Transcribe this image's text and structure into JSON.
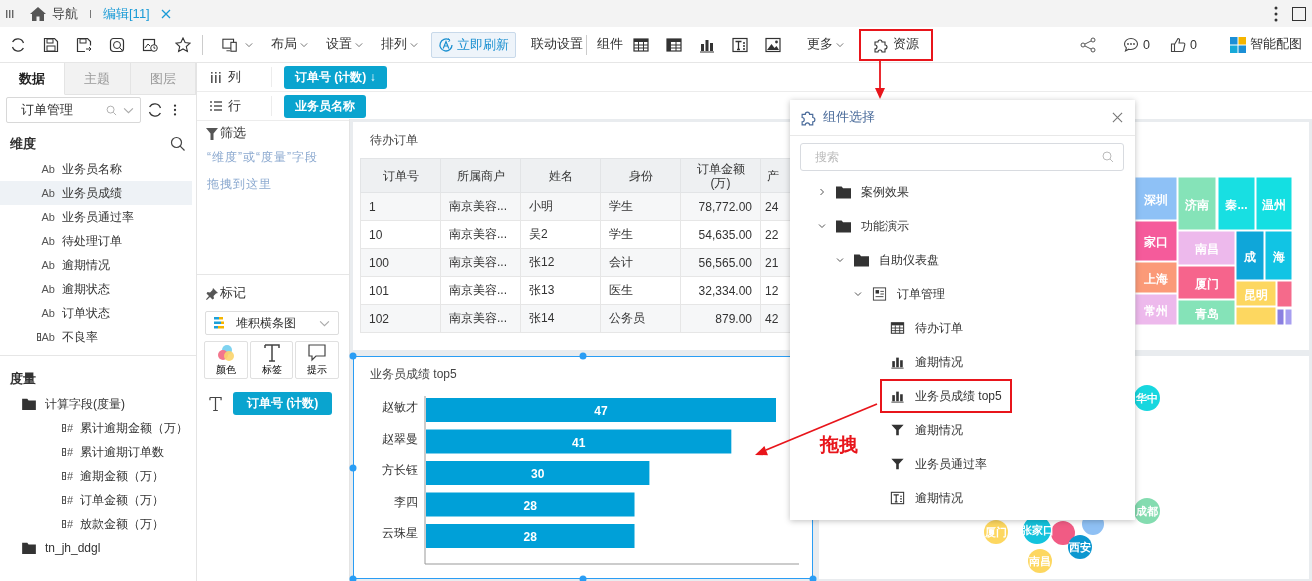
{
  "top_tabs": [
    {
      "label": "导航",
      "kind": "home",
      "selected": false
    },
    {
      "label": "编辑[11]",
      "kind": "edit",
      "selected": true
    }
  ],
  "toolbar": {
    "menus": [
      "布局",
      "设置",
      "排列"
    ],
    "refresh_button": "立即刷新",
    "link_settings": "联动设置",
    "components_label": "组件",
    "more": "更多",
    "resources": {
      "label": "资源",
      "highlighted": true
    },
    "comments": "0",
    "likes": "0",
    "smart_chart": "智能配图"
  },
  "left_panel": {
    "tabs": [
      {
        "label": "数据",
        "selected": true
      },
      {
        "label": "主题",
        "selected": false
      },
      {
        "label": "图层",
        "selected": false
      }
    ],
    "dataset": "订单管理",
    "dimensions": {
      "title": "维度",
      "items": [
        {
          "label": "业务员名称",
          "glyph": "Ab",
          "calculated": false,
          "selected": false
        },
        {
          "label": "业务员成绩",
          "glyph": "Ab",
          "calculated": false,
          "selected": true
        },
        {
          "label": "业务员通过率",
          "glyph": "Ab",
          "calculated": false,
          "selected": false
        },
        {
          "label": "待处理订单",
          "glyph": "Ab",
          "calculated": false,
          "selected": false
        },
        {
          "label": "逾期情况",
          "glyph": "Ab",
          "calculated": false,
          "selected": false
        },
        {
          "label": "逾期状态",
          "glyph": "Ab",
          "calculated": false,
          "selected": false
        },
        {
          "label": "订单状态",
          "glyph": "Ab",
          "calculated": false,
          "selected": false
        },
        {
          "label": "不良率",
          "glyph": "Ab",
          "calculated": true,
          "selected": false
        }
      ]
    },
    "measures": {
      "title": "度量",
      "items": [
        {
          "label": "计算字段(度量)",
          "kind": "folder",
          "children": [
            {
              "label": "累计逾期金额（万）",
              "kind": "field",
              "glyph": "#",
              "calculated": true
            },
            {
              "label": "累计逾期订单数",
              "kind": "field",
              "glyph": "#",
              "calculated": true
            },
            {
              "label": "逾期金额（万）",
              "kind": "field",
              "glyph": "#",
              "calculated": true
            },
            {
              "label": "订单金额（万）",
              "kind": "field",
              "glyph": "#",
              "calculated": true
            },
            {
              "label": "放款金额（万）",
              "kind": "field",
              "glyph": "#",
              "calculated": true
            }
          ]
        },
        {
          "label": "tn_jh_ddgl",
          "kind": "folder"
        }
      ]
    }
  },
  "filter": {
    "title": "筛选",
    "hint": "“维度”或“度量”字段拖拽到这里"
  },
  "marks": {
    "title": "标记",
    "chart_type": "堆积横条图",
    "buttons": [
      {
        "label": "颜色",
        "kind": "color"
      },
      {
        "label": "标签",
        "kind": "label"
      },
      {
        "label": "提示",
        "kind": "tooltip"
      }
    ],
    "label_field": "订单号 (计数)"
  },
  "shelves": [
    {
      "label": "列",
      "kind": "columns",
      "pill": "订单号 (计数) ↓"
    },
    {
      "label": "行",
      "kind": "rows",
      "pill": "业务员名称"
    }
  ],
  "table_widget": {
    "title": "待办订单",
    "columns": [
      "订单号",
      "所属商户",
      "姓名",
      "身份",
      "订单金额\n(万)",
      "产"
    ],
    "rows": [
      [
        "1",
        "南京美容...",
        "小明",
        "学生",
        "78,772.00",
        "24"
      ],
      [
        "10",
        "南京美容...",
        "吴2",
        "学生",
        "54,635.00",
        "22"
      ],
      [
        "100",
        "南京美容...",
        "张12",
        "会计",
        "56,565.00",
        "21"
      ],
      [
        "101",
        "南京美容...",
        "张13",
        "医生",
        "32,334.00",
        "12"
      ],
      [
        "102",
        "南京美容...",
        "张14",
        "公务员",
        "879.00",
        "42"
      ]
    ]
  },
  "bar_widget": {
    "title": "业务员成绩 top5",
    "selected": true,
    "chart_data": {
      "type": "bar",
      "orientation": "horizontal",
      "categories": [
        "赵敏才",
        "赵翠曼",
        "方长钰",
        "李四",
        "云珠星"
      ],
      "series": [
        {
          "color": "#00a0d8",
          "values": [
            47,
            41,
            30,
            28,
            28
          ]
        }
      ],
      "data_labels": true
    }
  },
  "treemap_widget": {
    "cells": [
      {
        "label": "深圳",
        "color": "#8ec1f6"
      },
      {
        "label": "家口",
        "color": "#f55b9b"
      },
      {
        "label": "上海",
        "color": "#fb9a78"
      },
      {
        "label": "常州",
        "color": "#edb9ec"
      },
      {
        "label": "济南",
        "color": "#85e3b8"
      },
      {
        "label": "秦...",
        "color": "#18dfe2"
      },
      {
        "label": "温州",
        "color": "#14dfe2"
      },
      {
        "label": "南昌",
        "color": "#edb9ec"
      },
      {
        "label": "成",
        "color": "#0fa6d9"
      },
      {
        "label": "海",
        "color": "#11c4e4"
      },
      {
        "label": "厦门",
        "color": "#f6648c"
      },
      {
        "label": "昆明",
        "color": "#fdd760"
      },
      {
        "color": "#f56a8b"
      },
      {
        "label": "青岛",
        "color": "#85e3b8"
      },
      {
        "color": "#fdd760"
      },
      {
        "color": "#8a7fe0"
      },
      {
        "color": "#a79ef0"
      }
    ]
  },
  "bubble_widget": {
    "bubbles": [
      {
        "label": "华中",
        "color": "#17d7df"
      },
      {
        "label": "成都",
        "color": "#84dcb0"
      },
      {
        "label": "厦门",
        "color": "#fdd760"
      },
      {
        "color": "#f15b84"
      },
      {
        "color": "#8fc0f4"
      },
      {
        "label": "张家口",
        "color": "#13c3dd"
      },
      {
        "label": "西安",
        "color": "#0c97d0"
      },
      {
        "label": "南昌",
        "color": "#fdd760"
      }
    ]
  },
  "component_picker": {
    "title": "组件选择",
    "search": {
      "placeholder": "搜索"
    },
    "tree": [
      {
        "label": "案例效果",
        "kind": "folder",
        "expanded": false
      },
      {
        "label": "功能演示",
        "kind": "folder",
        "expanded": true,
        "children": [
          {
            "label": "自助仪表盘",
            "kind": "folder",
            "expanded": true,
            "children": [
              {
                "label": "订单管理",
                "kind": "dashboard",
                "expanded": true,
                "children": [
                  {
                    "label": "待办订单",
                    "kind": "table",
                    "highlighted": false
                  },
                  {
                    "label": "逾期情况",
                    "kind": "bar",
                    "highlighted": false
                  },
                  {
                    "label": "业务员成绩 top5",
                    "kind": "bar",
                    "highlighted": true
                  },
                  {
                    "label": "逾期情况",
                    "kind": "filter",
                    "highlighted": false
                  },
                  {
                    "label": "业务员通过率",
                    "kind": "filter",
                    "highlighted": false
                  },
                  {
                    "label": "逾期情况",
                    "kind": "text",
                    "highlighted": false
                  }
                ]
              }
            ]
          }
        ]
      }
    ]
  },
  "annotation": {
    "label": "拖拽"
  }
}
